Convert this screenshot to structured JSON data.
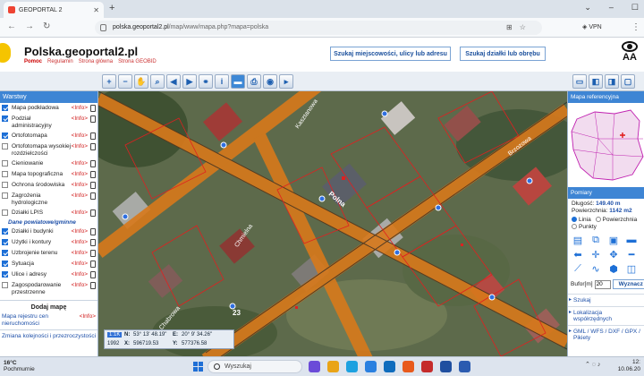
{
  "browser": {
    "tab_title": "GEOPORTAL 2",
    "url_domain": "polska.geoportal2.pl",
    "url_path": "/map/www/mapa.php?mapa=polska",
    "vpn_label": "VPN"
  },
  "header": {
    "site_title": "Polska.geoportal2.pl",
    "links": [
      "Pomoc",
      "Regulamin",
      "Strona główna",
      "Strona GEOBID"
    ],
    "search_address_button": "Szukaj miejscowości, ulicy lub adresu",
    "search_parcel_button": "Szukaj działki lub obrębu",
    "accessibility_text": "AA"
  },
  "layers_panel": {
    "title": "Warstwy",
    "info_label": "<Info>",
    "layers": [
      {
        "name": "Mapa podkładowa",
        "checked": true
      },
      {
        "name": "Podział administracyjny",
        "checked": true
      },
      {
        "name": "Ortofotomapa",
        "checked": true
      },
      {
        "name": "Ortofotomapa wysokiej rozdzielczości",
        "checked": false
      },
      {
        "name": "Cieniowanie",
        "checked": false
      },
      {
        "name": "Mapa topograficzna",
        "checked": false
      },
      {
        "name": "Ochrona środowiska",
        "checked": false
      },
      {
        "name": "Zagrożenia hydrologiczne",
        "checked": false
      },
      {
        "name": "Działki LPIS",
        "checked": false
      }
    ],
    "county_data_label": "Dane powiatowe/gminne",
    "county_layers": [
      {
        "name": "Działki i budynki",
        "checked": true
      },
      {
        "name": "Użytki i kontury",
        "checked": true
      },
      {
        "name": "Uzbrojenie terenu",
        "checked": true
      },
      {
        "name": "Sytuacja",
        "checked": true
      },
      {
        "name": "Ulice i adresy",
        "checked": true
      },
      {
        "name": "Zagospodarowanie przestrzenne",
        "checked": false
      }
    ],
    "add_map_label": "Dodaj mapę",
    "extra_links": [
      {
        "name": "Mapa rejestru cen nieruchomości",
        "info": "<Info>"
      },
      {
        "name": "Zmiana kolejności i przezroczystości",
        "info": ""
      }
    ]
  },
  "coordinates": {
    "scale": "1:1K",
    "epsg": "1992",
    "n_label": "N:",
    "n_value": "53° 13' 48.19\"",
    "e_label": "E:",
    "e_value": "20° 9' 34.26\"",
    "x_label": "X:",
    "x_value": "596719.53",
    "y_label": "Y:",
    "y_value": "577376.58"
  },
  "map_labels": {
    "street_1": "Kasztanowa",
    "street_2": "Chmielna",
    "street_3": "Chabrowa",
    "street_4": "Brzozowa",
    "street_5": "Polna",
    "house_number": "23"
  },
  "right_panel": {
    "reference_map_title": "Mapa referencyjna",
    "measure_title": "Pomiary",
    "length_label": "Długość:",
    "length_value": "149.40 m",
    "area_label": "Powierzchnia:",
    "area_value": "1142 m2",
    "mode_line": "Linia",
    "mode_area": "Powierzchnia",
    "mode_points": "Punkty",
    "buffer_label": "Bufor[m]",
    "buffer_value": "20",
    "draw_button": "Wyznacz",
    "collapsed_sections": [
      "Szukaj",
      "Lokalizacja współrzędnych",
      "GML / WFS / DXF / GPX / Pikiety"
    ]
  },
  "taskbar": {
    "temperature": "16°C",
    "weather_text": "Pochmurnie",
    "search_placeholder": "Wyszukaj",
    "time": "12:",
    "date": "10.06.20"
  }
}
